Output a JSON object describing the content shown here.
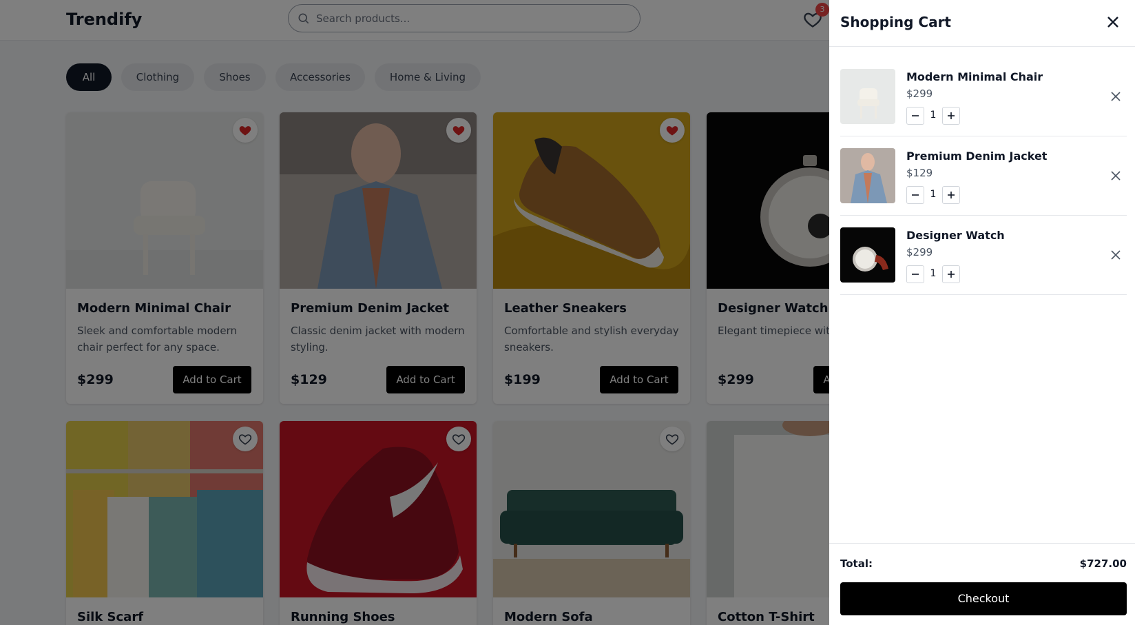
{
  "header": {
    "logo": "Trendify",
    "search_placeholder": "Search products...",
    "wishlist_count": "3"
  },
  "categories": [
    "All",
    "Clothing",
    "Shoes",
    "Accessories",
    "Home & Living"
  ],
  "active_category": "All",
  "products": [
    {
      "title": "Modern Minimal Chair",
      "desc": "Sleek and comfortable modern chair perfect for any space.",
      "price": "$299",
      "button": "Add to Cart",
      "favorited": true
    },
    {
      "title": "Premium Denim Jacket",
      "desc": "Classic denim jacket with modern styling.",
      "price": "$129",
      "button": "Add to Cart",
      "favorited": true
    },
    {
      "title": "Leather Sneakers",
      "desc": "Comfortable and stylish everyday sneakers.",
      "price": "$199",
      "button": "Add to Cart",
      "favorited": true
    },
    {
      "title": "Designer Watch",
      "desc": "Elegant timepiece with materials.",
      "price": "$299",
      "button": "Add to Cart",
      "favorited": false
    },
    {
      "title": "Silk Scarf",
      "favorited": false
    },
    {
      "title": "Running Shoes",
      "favorited": false
    },
    {
      "title": "Modern Sofa",
      "favorited": false
    },
    {
      "title": "Cotton T-Shirt",
      "favorited": false
    }
  ],
  "cart": {
    "title": "Shopping Cart",
    "items": [
      {
        "name": "Modern Minimal Chair",
        "price": "$299",
        "qty": "1"
      },
      {
        "name": "Premium Denim Jacket",
        "price": "$129",
        "qty": "1"
      },
      {
        "name": "Designer Watch",
        "price": "$299",
        "qty": "1"
      }
    ],
    "total_label": "Total:",
    "total_value": "$727.00",
    "checkout_label": "Checkout"
  },
  "colors": {
    "accent": "#000000",
    "favorite": "#dc2626",
    "badge": "#ef4444"
  }
}
